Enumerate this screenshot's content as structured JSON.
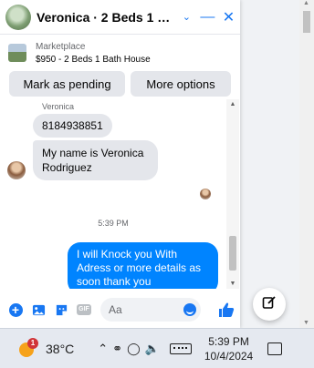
{
  "header": {
    "title": "Veronica · 2 Beds 1 Bath H…",
    "icons": [
      "chevron-down-icon",
      "minimize-icon",
      "close-icon"
    ]
  },
  "listing": {
    "source": "Marketplace",
    "summary": "$950 - 2 Beds 1 Bath House"
  },
  "actions": {
    "pending_label": "Mark as pending",
    "more_label": "More options"
  },
  "conversation": {
    "sender_name": "Veronica",
    "messages": [
      {
        "from": "them",
        "text": "8184938851"
      },
      {
        "from": "them",
        "text": "My name is Veronica Rodriguez"
      }
    ],
    "timestamp": "5:39 PM",
    "my_message": "I will Knock you With Adress or more details  as soon thank you"
  },
  "composer": {
    "placeholder": "Aa",
    "icons": [
      "add-icon",
      "photo-icon",
      "sticker-icon",
      "gif-icon",
      "emoji-icon",
      "like-icon"
    ],
    "gif_label": "GIF"
  },
  "taskbar": {
    "weather_badge": "1",
    "temperature": "38°C",
    "time": "5:39 PM",
    "date": "10/4/2024"
  },
  "colors": {
    "accent": "#1877f2",
    "my_bubble": "#0084ff",
    "their_bubble": "#e4e6eb"
  }
}
